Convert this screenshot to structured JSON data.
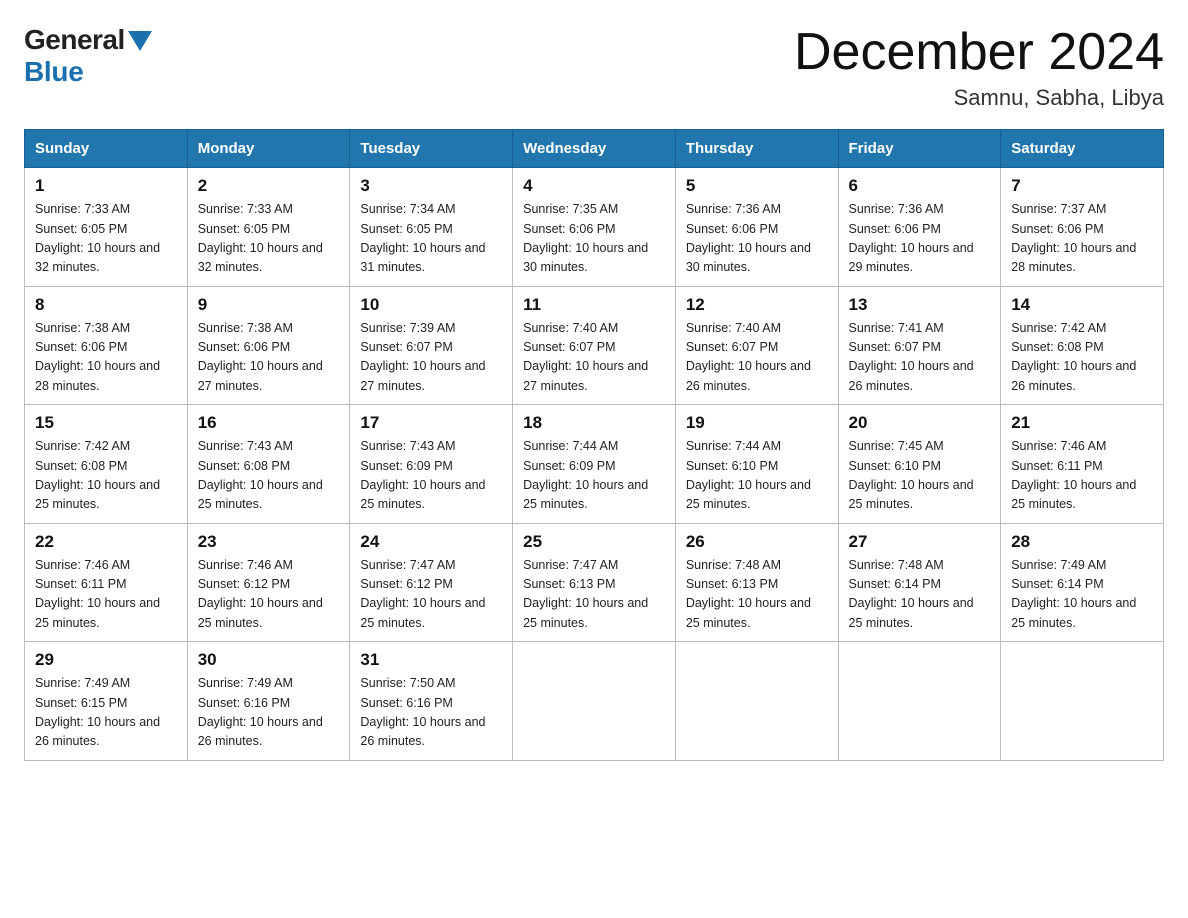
{
  "header": {
    "logo_general": "General",
    "logo_blue": "Blue",
    "month_title": "December 2024",
    "location": "Samnu, Sabha, Libya"
  },
  "days_of_week": [
    "Sunday",
    "Monday",
    "Tuesday",
    "Wednesday",
    "Thursday",
    "Friday",
    "Saturday"
  ],
  "weeks": [
    [
      {
        "day": "1",
        "sunrise": "7:33 AM",
        "sunset": "6:05 PM",
        "daylight": "10 hours and 32 minutes."
      },
      {
        "day": "2",
        "sunrise": "7:33 AM",
        "sunset": "6:05 PM",
        "daylight": "10 hours and 32 minutes."
      },
      {
        "day": "3",
        "sunrise": "7:34 AM",
        "sunset": "6:05 PM",
        "daylight": "10 hours and 31 minutes."
      },
      {
        "day": "4",
        "sunrise": "7:35 AM",
        "sunset": "6:06 PM",
        "daylight": "10 hours and 30 minutes."
      },
      {
        "day": "5",
        "sunrise": "7:36 AM",
        "sunset": "6:06 PM",
        "daylight": "10 hours and 30 minutes."
      },
      {
        "day": "6",
        "sunrise": "7:36 AM",
        "sunset": "6:06 PM",
        "daylight": "10 hours and 29 minutes."
      },
      {
        "day": "7",
        "sunrise": "7:37 AM",
        "sunset": "6:06 PM",
        "daylight": "10 hours and 28 minutes."
      }
    ],
    [
      {
        "day": "8",
        "sunrise": "7:38 AM",
        "sunset": "6:06 PM",
        "daylight": "10 hours and 28 minutes."
      },
      {
        "day": "9",
        "sunrise": "7:38 AM",
        "sunset": "6:06 PM",
        "daylight": "10 hours and 27 minutes."
      },
      {
        "day": "10",
        "sunrise": "7:39 AM",
        "sunset": "6:07 PM",
        "daylight": "10 hours and 27 minutes."
      },
      {
        "day": "11",
        "sunrise": "7:40 AM",
        "sunset": "6:07 PM",
        "daylight": "10 hours and 27 minutes."
      },
      {
        "day": "12",
        "sunrise": "7:40 AM",
        "sunset": "6:07 PM",
        "daylight": "10 hours and 26 minutes."
      },
      {
        "day": "13",
        "sunrise": "7:41 AM",
        "sunset": "6:07 PM",
        "daylight": "10 hours and 26 minutes."
      },
      {
        "day": "14",
        "sunrise": "7:42 AM",
        "sunset": "6:08 PM",
        "daylight": "10 hours and 26 minutes."
      }
    ],
    [
      {
        "day": "15",
        "sunrise": "7:42 AM",
        "sunset": "6:08 PM",
        "daylight": "10 hours and 25 minutes."
      },
      {
        "day": "16",
        "sunrise": "7:43 AM",
        "sunset": "6:08 PM",
        "daylight": "10 hours and 25 minutes."
      },
      {
        "day": "17",
        "sunrise": "7:43 AM",
        "sunset": "6:09 PM",
        "daylight": "10 hours and 25 minutes."
      },
      {
        "day": "18",
        "sunrise": "7:44 AM",
        "sunset": "6:09 PM",
        "daylight": "10 hours and 25 minutes."
      },
      {
        "day": "19",
        "sunrise": "7:44 AM",
        "sunset": "6:10 PM",
        "daylight": "10 hours and 25 minutes."
      },
      {
        "day": "20",
        "sunrise": "7:45 AM",
        "sunset": "6:10 PM",
        "daylight": "10 hours and 25 minutes."
      },
      {
        "day": "21",
        "sunrise": "7:46 AM",
        "sunset": "6:11 PM",
        "daylight": "10 hours and 25 minutes."
      }
    ],
    [
      {
        "day": "22",
        "sunrise": "7:46 AM",
        "sunset": "6:11 PM",
        "daylight": "10 hours and 25 minutes."
      },
      {
        "day": "23",
        "sunrise": "7:46 AM",
        "sunset": "6:12 PM",
        "daylight": "10 hours and 25 minutes."
      },
      {
        "day": "24",
        "sunrise": "7:47 AM",
        "sunset": "6:12 PM",
        "daylight": "10 hours and 25 minutes."
      },
      {
        "day": "25",
        "sunrise": "7:47 AM",
        "sunset": "6:13 PM",
        "daylight": "10 hours and 25 minutes."
      },
      {
        "day": "26",
        "sunrise": "7:48 AM",
        "sunset": "6:13 PM",
        "daylight": "10 hours and 25 minutes."
      },
      {
        "day": "27",
        "sunrise": "7:48 AM",
        "sunset": "6:14 PM",
        "daylight": "10 hours and 25 minutes."
      },
      {
        "day": "28",
        "sunrise": "7:49 AM",
        "sunset": "6:14 PM",
        "daylight": "10 hours and 25 minutes."
      }
    ],
    [
      {
        "day": "29",
        "sunrise": "7:49 AM",
        "sunset": "6:15 PM",
        "daylight": "10 hours and 26 minutes."
      },
      {
        "day": "30",
        "sunrise": "7:49 AM",
        "sunset": "6:16 PM",
        "daylight": "10 hours and 26 minutes."
      },
      {
        "day": "31",
        "sunrise": "7:50 AM",
        "sunset": "6:16 PM",
        "daylight": "10 hours and 26 minutes."
      },
      null,
      null,
      null,
      null
    ]
  ],
  "labels": {
    "sunrise_prefix": "Sunrise: ",
    "sunset_prefix": "Sunset: ",
    "daylight_prefix": "Daylight: "
  }
}
